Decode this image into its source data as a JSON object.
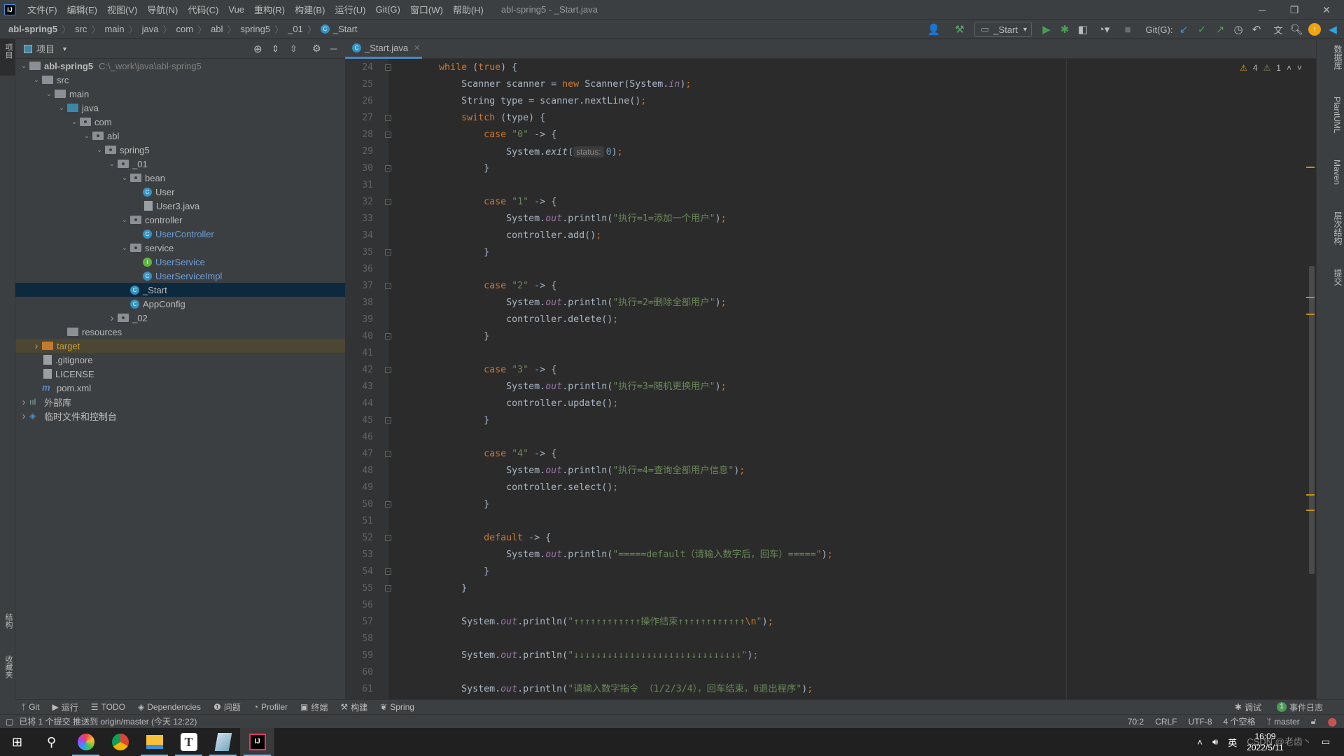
{
  "app": {
    "logo": "IJ",
    "window_title": "abl-spring5 - _Start.java"
  },
  "menu": [
    "文件(F)",
    "编辑(E)",
    "视图(V)",
    "导航(N)",
    "代码(C)",
    "Vue",
    "重构(R)",
    "构建(B)",
    "运行(U)",
    "Git(G)",
    "窗口(W)",
    "帮助(H)"
  ],
  "breadcrumb": [
    "abl-spring5",
    "src",
    "main",
    "java",
    "com",
    "abl",
    "spring5",
    "_01",
    "_Start"
  ],
  "toolbar": {
    "run_config": "_Start",
    "git_label": "Git(G):"
  },
  "left_strip": {
    "project": "项目",
    "structure": "结构",
    "favorites": "收藏夹"
  },
  "project_panel": {
    "title": "项目"
  },
  "tree": [
    {
      "level": 0,
      "arrow": "open",
      "icon": "module",
      "label": "abl-spring5",
      "bold": true,
      "path": "C:\\_work\\java\\abl-spring5"
    },
    {
      "level": 1,
      "arrow": "open",
      "icon": "folder",
      "label": "src"
    },
    {
      "level": 2,
      "arrow": "open",
      "icon": "folder",
      "label": "main"
    },
    {
      "level": 3,
      "arrow": "open",
      "icon": "folder-blue",
      "label": "java"
    },
    {
      "level": 4,
      "arrow": "open",
      "icon": "package",
      "label": "com"
    },
    {
      "level": 5,
      "arrow": "open",
      "icon": "package",
      "label": "abl"
    },
    {
      "level": 6,
      "arrow": "open",
      "icon": "package",
      "label": "spring5"
    },
    {
      "level": 7,
      "arrow": "open",
      "icon": "package",
      "label": "_01"
    },
    {
      "level": 8,
      "arrow": "open",
      "icon": "package",
      "label": "bean"
    },
    {
      "level": 9,
      "arrow": "none",
      "icon": "class",
      "label": "User"
    },
    {
      "level": 9,
      "arrow": "none",
      "icon": "java-file",
      "label": "User3.java"
    },
    {
      "level": 8,
      "arrow": "open",
      "icon": "package",
      "label": "controller"
    },
    {
      "level": 9,
      "arrow": "none",
      "icon": "class",
      "label": "UserController",
      "color": "#6c9fd8"
    },
    {
      "level": 8,
      "arrow": "open",
      "icon": "package",
      "label": "service"
    },
    {
      "level": 9,
      "arrow": "none",
      "icon": "interface",
      "label": "UserService",
      "color": "#6c9fd8"
    },
    {
      "level": 9,
      "arrow": "none",
      "icon": "class",
      "label": "UserServiceImpl",
      "color": "#6c9fd8"
    },
    {
      "level": 8,
      "arrow": "none",
      "icon": "class",
      "label": "_Start",
      "selected": true
    },
    {
      "level": 8,
      "arrow": "none",
      "icon": "class",
      "label": "AppConfig"
    },
    {
      "level": 7,
      "arrow": "closed",
      "icon": "package",
      "label": "_02"
    },
    {
      "level": 3,
      "arrow": "none",
      "icon": "folder",
      "label": "resources"
    },
    {
      "level": 1,
      "arrow": "closed",
      "icon": "folder-orange",
      "label": "target",
      "color": "#c9a03a",
      "highlight": true
    },
    {
      "level": 1,
      "arrow": "none",
      "icon": "file",
      "label": ".gitignore"
    },
    {
      "level": 1,
      "arrow": "none",
      "icon": "file",
      "label": "LICENSE"
    },
    {
      "level": 1,
      "arrow": "none",
      "icon": "maven",
      "label": "pom.xml"
    },
    {
      "level": 0,
      "arrow": "closed",
      "icon": "library",
      "label": "外部库"
    },
    {
      "level": 0,
      "arrow": "closed",
      "icon": "scratch",
      "label": "临时文件和控制台"
    }
  ],
  "editor": {
    "tab": "_Start.java",
    "inspections": {
      "warnings": "4",
      "weak_warnings": "1"
    },
    "folds": [
      24,
      27,
      28,
      30,
      32,
      35,
      37,
      40,
      42,
      45,
      47,
      50,
      52,
      54,
      55
    ],
    "lines": [
      {
        "n": 24,
        "t": [
          [
            "",
            "        "
          ],
          [
            "k",
            "while"
          ],
          [
            "",
            " ("
          ],
          [
            "k",
            "true"
          ],
          [
            "",
            ") {"
          ]
        ]
      },
      {
        "n": 25,
        "t": [
          [
            "",
            "            Scanner scanner = "
          ],
          [
            "k",
            "new"
          ],
          [
            "",
            " Scanner(System."
          ],
          [
            "f",
            "in"
          ],
          [
            "",
            ")"
          ],
          [
            "sc",
            ";"
          ]
        ]
      },
      {
        "n": 26,
        "t": [
          [
            "",
            "            String type = scanner.nextLine()"
          ],
          [
            "sc",
            ";"
          ]
        ]
      },
      {
        "n": 27,
        "t": [
          [
            "",
            "            "
          ],
          [
            "k",
            "switch"
          ],
          [
            "",
            " (type) {"
          ]
        ]
      },
      {
        "n": 28,
        "t": [
          [
            "",
            "                "
          ],
          [
            "k",
            "case"
          ],
          [
            "",
            " "
          ],
          [
            "s",
            "\"0\""
          ],
          [
            "",
            " -> {"
          ]
        ]
      },
      {
        "n": 29,
        "t": [
          [
            "",
            "                    System."
          ],
          [
            "i",
            "exit"
          ],
          [
            "",
            "("
          ],
          [
            "hint",
            "status:"
          ],
          [
            "n",
            "0"
          ],
          [
            "",
            ")"
          ],
          [
            "sc",
            ";"
          ]
        ]
      },
      {
        "n": 30,
        "t": [
          [
            "",
            "                }"
          ]
        ]
      },
      {
        "n": 31,
        "t": []
      },
      {
        "n": 32,
        "t": [
          [
            "",
            "                "
          ],
          [
            "k",
            "case"
          ],
          [
            "",
            " "
          ],
          [
            "s",
            "\"1\""
          ],
          [
            "",
            " -> {"
          ]
        ]
      },
      {
        "n": 33,
        "t": [
          [
            "",
            "                    System."
          ],
          [
            "f",
            "out"
          ],
          [
            "",
            ".println("
          ],
          [
            "s",
            "\"执行=1=添加一个用户\""
          ],
          [
            "",
            ")"
          ],
          [
            "sc",
            ";"
          ]
        ]
      },
      {
        "n": 34,
        "t": [
          [
            "",
            "                    controller.add()"
          ],
          [
            "sc",
            ";"
          ]
        ]
      },
      {
        "n": 35,
        "t": [
          [
            "",
            "                }"
          ]
        ]
      },
      {
        "n": 36,
        "t": []
      },
      {
        "n": 37,
        "t": [
          [
            "",
            "                "
          ],
          [
            "k",
            "case"
          ],
          [
            "",
            " "
          ],
          [
            "s",
            "\"2\""
          ],
          [
            "",
            " -> {"
          ]
        ]
      },
      {
        "n": 38,
        "t": [
          [
            "",
            "                    System."
          ],
          [
            "f",
            "out"
          ],
          [
            "",
            ".println("
          ],
          [
            "s",
            "\"执行=2=删除全部用户\""
          ],
          [
            "",
            ")"
          ],
          [
            "sc",
            ";"
          ]
        ]
      },
      {
        "n": 39,
        "t": [
          [
            "",
            "                    controller.delete()"
          ],
          [
            "sc",
            ";"
          ]
        ]
      },
      {
        "n": 40,
        "t": [
          [
            "",
            "                }"
          ]
        ]
      },
      {
        "n": 41,
        "t": []
      },
      {
        "n": 42,
        "t": [
          [
            "",
            "                "
          ],
          [
            "k",
            "case"
          ],
          [
            "",
            " "
          ],
          [
            "s",
            "\"3\""
          ],
          [
            "",
            " -> {"
          ]
        ]
      },
      {
        "n": 43,
        "t": [
          [
            "",
            "                    System."
          ],
          [
            "f",
            "out"
          ],
          [
            "",
            ".println("
          ],
          [
            "s",
            "\"执行=3=随机更换用户\""
          ],
          [
            "",
            ")"
          ],
          [
            "sc",
            ";"
          ]
        ]
      },
      {
        "n": 44,
        "t": [
          [
            "",
            "                    controller.update()"
          ],
          [
            "sc",
            ";"
          ]
        ]
      },
      {
        "n": 45,
        "t": [
          [
            "",
            "                }"
          ]
        ]
      },
      {
        "n": 46,
        "t": []
      },
      {
        "n": 47,
        "t": [
          [
            "",
            "                "
          ],
          [
            "k",
            "case"
          ],
          [
            "",
            " "
          ],
          [
            "s",
            "\"4\""
          ],
          [
            "",
            " -> {"
          ]
        ]
      },
      {
        "n": 48,
        "t": [
          [
            "",
            "                    System."
          ],
          [
            "f",
            "out"
          ],
          [
            "",
            ".println("
          ],
          [
            "s",
            "\"执行=4=查询全部用户信息\""
          ],
          [
            "",
            ")"
          ],
          [
            "sc",
            ";"
          ]
        ]
      },
      {
        "n": 49,
        "t": [
          [
            "",
            "                    controller.select()"
          ],
          [
            "sc",
            ";"
          ]
        ]
      },
      {
        "n": 50,
        "t": [
          [
            "",
            "                }"
          ]
        ]
      },
      {
        "n": 51,
        "t": []
      },
      {
        "n": 52,
        "t": [
          [
            "",
            "                "
          ],
          [
            "k",
            "default"
          ],
          [
            "",
            " -> {"
          ]
        ]
      },
      {
        "n": 53,
        "t": [
          [
            "",
            "                    System."
          ],
          [
            "f",
            "out"
          ],
          [
            "",
            ".println("
          ],
          [
            "s",
            "\"=====default（请输入数字后，回车）=====\""
          ],
          [
            "",
            ")"
          ],
          [
            "sc",
            ";"
          ]
        ]
      },
      {
        "n": 54,
        "t": [
          [
            "",
            "                }"
          ]
        ]
      },
      {
        "n": 55,
        "t": [
          [
            "",
            "            }"
          ]
        ]
      },
      {
        "n": 56,
        "t": []
      },
      {
        "n": 57,
        "t": [
          [
            "",
            "            System."
          ],
          [
            "f",
            "out"
          ],
          [
            "",
            ".println("
          ],
          [
            "s",
            "\"↑↑↑↑↑↑↑↑↑↑↑↑操作结束↑↑↑↑↑↑↑↑↑↑↑↑"
          ],
          [
            "e",
            "\\n"
          ],
          [
            "s",
            "\""
          ],
          [
            "",
            ")"
          ],
          [
            "sc",
            ";"
          ]
        ]
      },
      {
        "n": 58,
        "t": []
      },
      {
        "n": 59,
        "t": [
          [
            "",
            "            System."
          ],
          [
            "f",
            "out"
          ],
          [
            "",
            ".println("
          ],
          [
            "s",
            "\"↓↓↓↓↓↓↓↓↓↓↓↓↓↓↓↓↓↓↓↓↓↓↓↓↓↓↓↓↓↓\""
          ],
          [
            "",
            ")"
          ],
          [
            "sc",
            ";"
          ]
        ]
      },
      {
        "n": 60,
        "t": []
      },
      {
        "n": 61,
        "t": [
          [
            "",
            "            System."
          ],
          [
            "f",
            "out"
          ],
          [
            "",
            ".println("
          ],
          [
            "s",
            "\"请输入数字指令 （1/2/3/4），回车结束，0退出程序\""
          ],
          [
            "",
            ")"
          ],
          [
            "sc",
            ";"
          ]
        ]
      }
    ]
  },
  "right_strip": [
    "数据库",
    "PlantUML",
    "Maven",
    "层次结构",
    "提交"
  ],
  "tool_tabs": {
    "git": "Git",
    "run": "运行",
    "todo": "TODO",
    "dependencies": "Dependencies",
    "problems": "问题",
    "profiler": "Profiler",
    "terminal": "终端",
    "build": "构建",
    "spring": "Spring",
    "debug": "调试",
    "event_log": "事件日志",
    "event_count": "1"
  },
  "status": {
    "message": "已将 1 个提交 推送到 origin/master (今天 12:22)",
    "position": "70:2",
    "line_sep": "CRLF",
    "encoding": "UTF-8",
    "indent": "4 个空格",
    "branch": "master"
  },
  "taskbar": {
    "ime": "英",
    "time": "16:09",
    "date": "2022/5/11",
    "watermark": "CSDN @老齿丶"
  }
}
